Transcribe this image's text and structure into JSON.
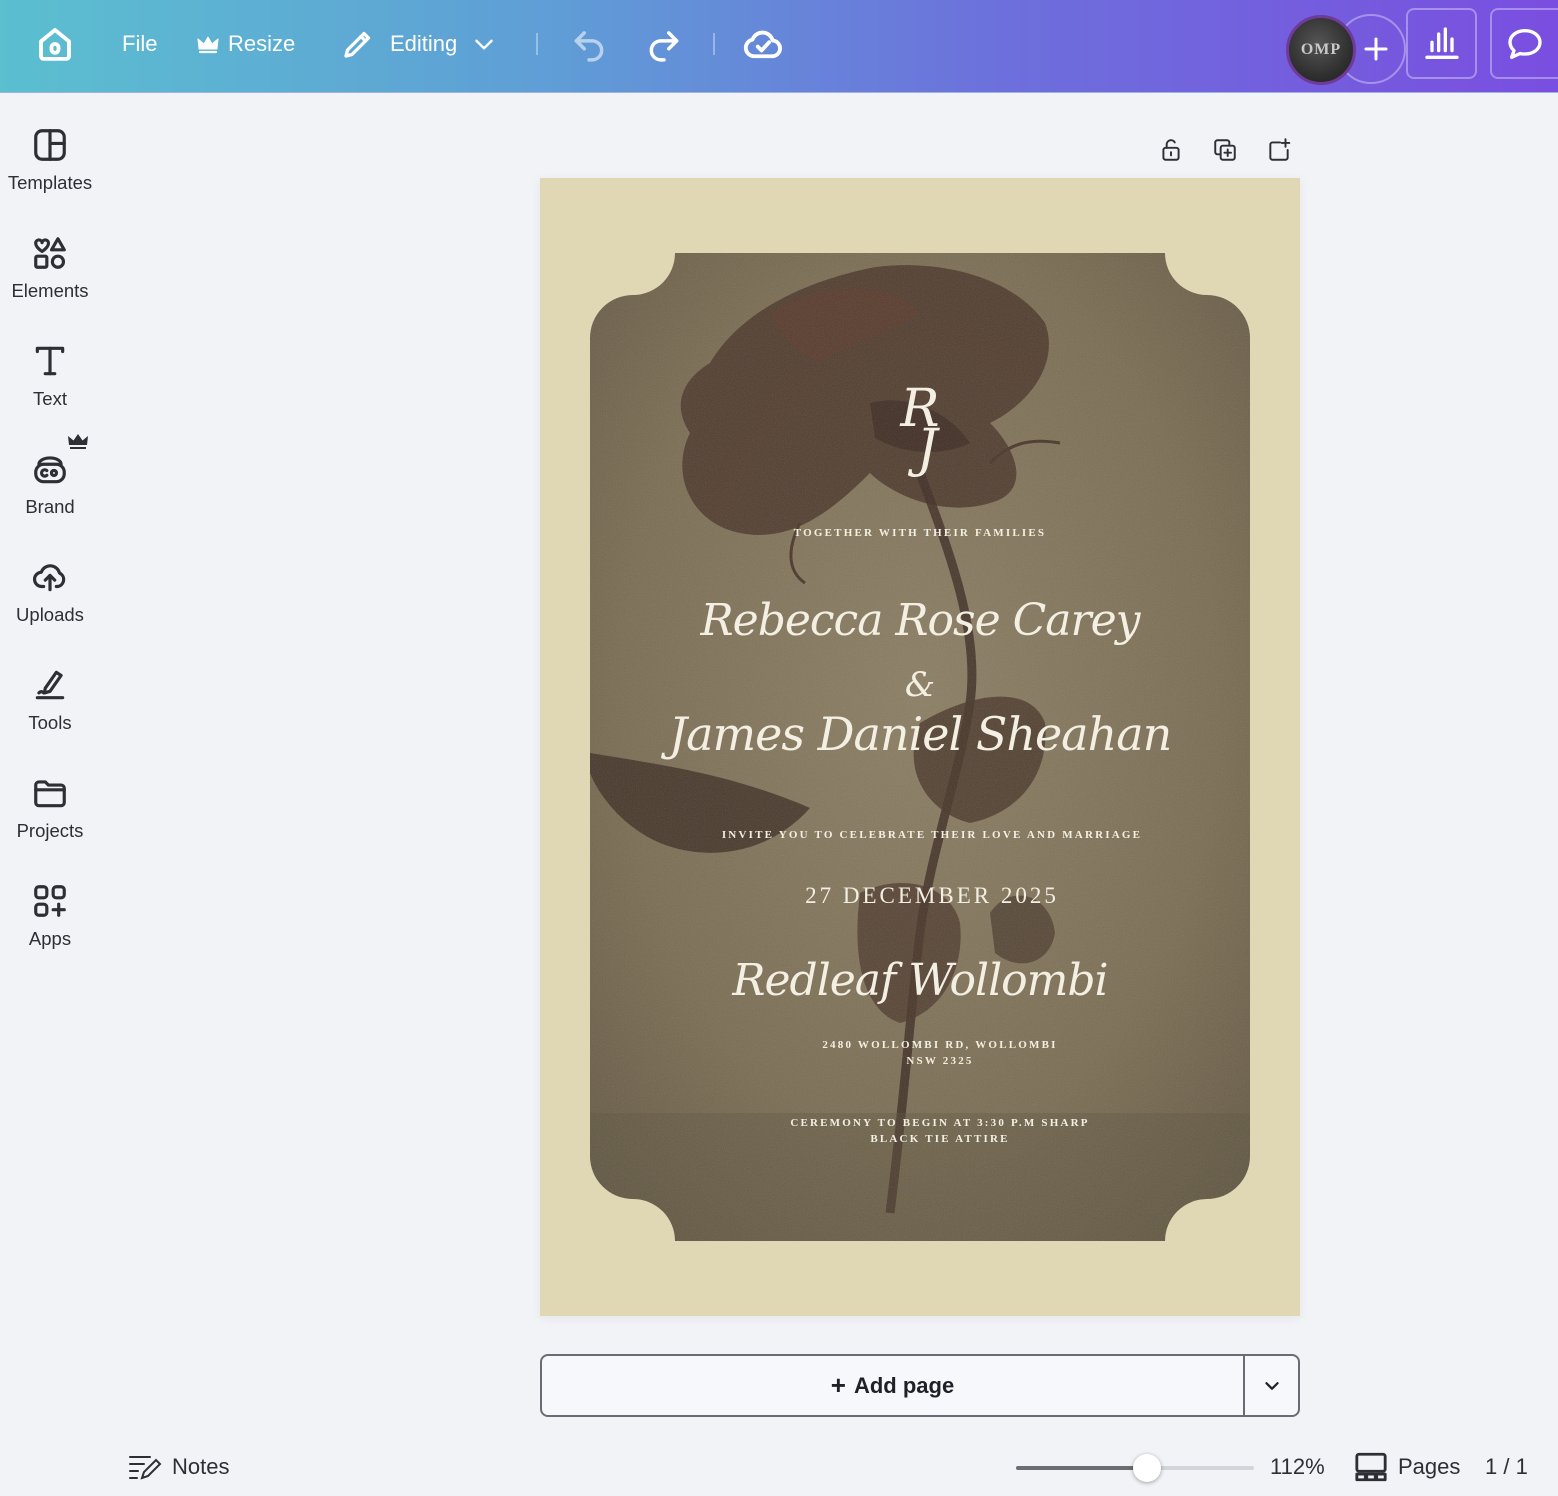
{
  "colors": {
    "accent_gradient_start": "#5bbfd0",
    "accent_gradient_end": "#7a4ee0",
    "page_background": "#e0d8b5",
    "card_color": "#7a6c52"
  },
  "toolbar": {
    "file_label": "File",
    "resize_label": "Resize",
    "editing_label": "Editing",
    "avatar_initials": "OMP",
    "icons": [
      "home-icon",
      "crown-icon",
      "pencil-icon",
      "chevron-down-icon",
      "undo-icon",
      "redo-icon",
      "cloud-check-icon",
      "plus-icon",
      "analytics-icon",
      "comment-icon"
    ]
  },
  "sidebar": {
    "items": [
      {
        "label": "Templates",
        "icon": "templates-icon"
      },
      {
        "label": "Elements",
        "icon": "elements-icon"
      },
      {
        "label": "Text",
        "icon": "text-icon"
      },
      {
        "label": "Brand",
        "icon": "brand-icon"
      },
      {
        "label": "Uploads",
        "icon": "upload-cloud-icon"
      },
      {
        "label": "Tools",
        "icon": "tools-icon"
      },
      {
        "label": "Projects",
        "icon": "folder-icon"
      },
      {
        "label": "Apps",
        "icon": "apps-icon"
      }
    ]
  },
  "invitation": {
    "monogram_top": "R",
    "monogram_bottom": "J",
    "intro": "TOGETHER WITH THEIR FAMILIES",
    "bride": "Rebecca Rose Carey",
    "ampersand": "&",
    "groom": "James Daniel Sheahan",
    "invite_line": "INVITE YOU TO CELEBRATE THEIR LOVE AND MARRIAGE",
    "date": "27 DECEMBER 2025",
    "venue": "Redleaf Wollombi",
    "address_line1": "2480 WOLLOMBI RD, WOLLOMBI",
    "address_line2": "NSW 2325",
    "ceremony_line": "CEREMONY TO BEGIN AT 3:30 P.M SHARP",
    "attire_line": "BLACK TIE ATTIRE"
  },
  "page_actions": [
    "lock-icon",
    "duplicate-page-icon",
    "add-page-icon"
  ],
  "add_page": {
    "plus": "+",
    "label": "Add page"
  },
  "bottom_bar": {
    "notes_label": "Notes",
    "zoom_value": "112%",
    "zoom_fraction": 0.55,
    "pages_label": "Pages",
    "page_count": "1 / 1"
  }
}
